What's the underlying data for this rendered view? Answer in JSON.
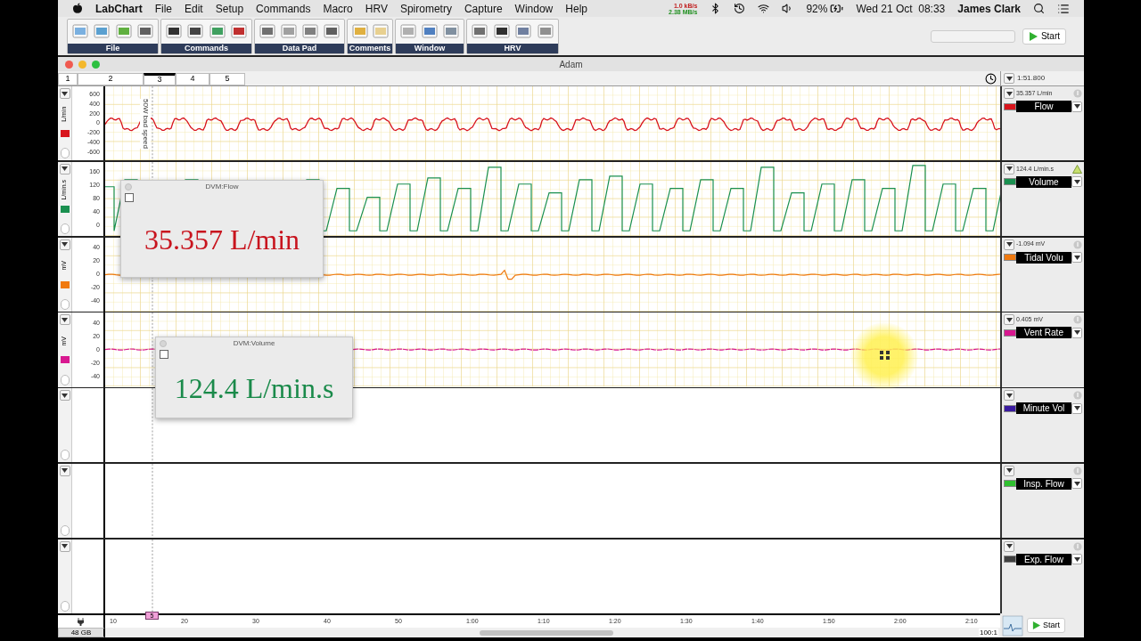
{
  "menu_bar": {
    "app": "LabChart",
    "items": [
      "File",
      "Edit",
      "Setup",
      "Commands",
      "Macro",
      "HRV",
      "Spirometry",
      "Capture",
      "Window",
      "Help"
    ],
    "net_up": "1.0 kB/s",
    "net_down": "2.38 MB/s",
    "battery": "92%",
    "clock": "Wed 21 Oct  08:33",
    "user": "James Clark"
  },
  "toolbar": {
    "groups": [
      "File",
      "Commands",
      "Data Pad",
      "Comments",
      "Window",
      "HRV"
    ],
    "start_button": "Start"
  },
  "window": {
    "title": "Adam",
    "tabs": [
      {
        "label": "1",
        "selected": false
      },
      {
        "label": "2",
        "selected": false
      },
      {
        "label": "3",
        "selected": true
      },
      {
        "label": "4",
        "selected": false
      },
      {
        "label": "5",
        "selected": false
      }
    ],
    "time": "1:51.800"
  },
  "comment": "50W bad speed",
  "channels": [
    {
      "name": "Flow",
      "unit": "L/min",
      "color": "#d8141c",
      "reading": "35.357 L/min",
      "alert": {
        "kind": "info"
      },
      "kind": "pulse",
      "ticks": [
        "600",
        "400",
        "200",
        "0",
        "-200",
        "-400",
        "-600"
      ]
    },
    {
      "name": "Volume",
      "unit": "L/min.s",
      "color": "#1a9050",
      "reading": "124.4 L/min.s",
      "alert": {
        "kind": "warning"
      },
      "kind": "ramp",
      "ticks": [
        "160",
        "120",
        "80",
        "40",
        "0"
      ]
    },
    {
      "name": "Tidal Volu",
      "unit": "mV",
      "color": "#f07a10",
      "reading": "-1.094 mV",
      "alert": {
        "kind": "info"
      },
      "kind": "flat",
      "ticks": [
        "40",
        "20",
        "0",
        "-20",
        "-40"
      ]
    },
    {
      "name": "Vent Rate",
      "unit": "mV",
      "color": "#d81890",
      "reading": "0.405 mV",
      "alert": {
        "kind": "info"
      },
      "kind": "dotted",
      "ticks": [
        "40",
        "20",
        "0",
        "-20",
        "-40"
      ]
    },
    {
      "name": "Minute Vol",
      "color": "#3a1aa0",
      "alert": {
        "kind": "info"
      },
      "kind": "empty"
    },
    {
      "name": "Insp. Flow",
      "color": "#30c030",
      "alert": {
        "kind": "info"
      },
      "kind": "empty"
    },
    {
      "name": "Exp. Flow",
      "color": "#404040",
      "alert": {
        "kind": "info"
      },
      "kind": "empty"
    }
  ],
  "time_axis": {
    "ticks": [
      "10",
      "20",
      "30",
      "40",
      "50",
      "1:00",
      "1:10",
      "1:20",
      "1:30",
      "1:40",
      "1:50",
      "2:00",
      "2:10"
    ],
    "marker": "5",
    "disk": "48 GB",
    "zoom": "100:1",
    "start_button": "Start"
  },
  "dvm": [
    {
      "title": "DVM:Flow",
      "value": "35.357 L/min",
      "color": "#c8141e"
    },
    {
      "title": "DVM:Volume",
      "value": "124.4 L/min.s",
      "color": "#1a8a4a"
    }
  ]
}
